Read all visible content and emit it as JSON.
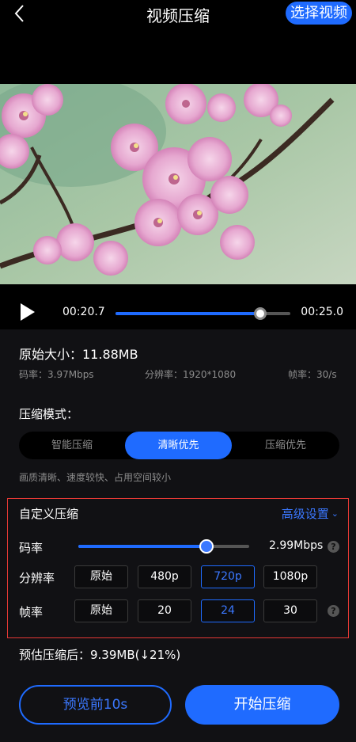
{
  "header": {
    "back_icon": "chevron-left-icon",
    "title": "视频压缩",
    "select_label": "选择视频"
  },
  "player": {
    "play_icon": "play-icon",
    "current_time": "00:20.7",
    "total_time": "00:25.0",
    "progress": 0.83
  },
  "info": {
    "original_size": "原始大小：11.88MB",
    "bitrate": "码率：3.97Mbps",
    "resolution": "分辨率：1920*1080",
    "framerate": "帧率：30/s"
  },
  "mode": {
    "label": "压缩模式：",
    "options": [
      "智能压缩",
      "清晰优先",
      "压缩优先"
    ],
    "selected": "清晰优先",
    "description": "画质清晰、速度较快、占用空间较小"
  },
  "custom": {
    "title": "自定义压缩",
    "advanced_label": "高级设置",
    "bitrate_label": "码率",
    "bitrate_value": "2.99Mbps",
    "bitrate_fraction": 0.75,
    "resolution_label": "分辨率",
    "resolution_options": [
      "原始",
      "480p",
      "720p",
      "1080p"
    ],
    "resolution_selected": "720p",
    "framerate_label": "帧率",
    "framerate_options": [
      "原始",
      "20",
      "24",
      "30"
    ],
    "framerate_selected": "24",
    "help_text": "?"
  },
  "estimate": "预估压缩后：9.39MB(↓21%)",
  "actions": {
    "preview_label": "预览前10s",
    "start_label": "开始压缩"
  },
  "colors": {
    "accent": "#1f6bff",
    "highlight_border": "#e53935"
  }
}
